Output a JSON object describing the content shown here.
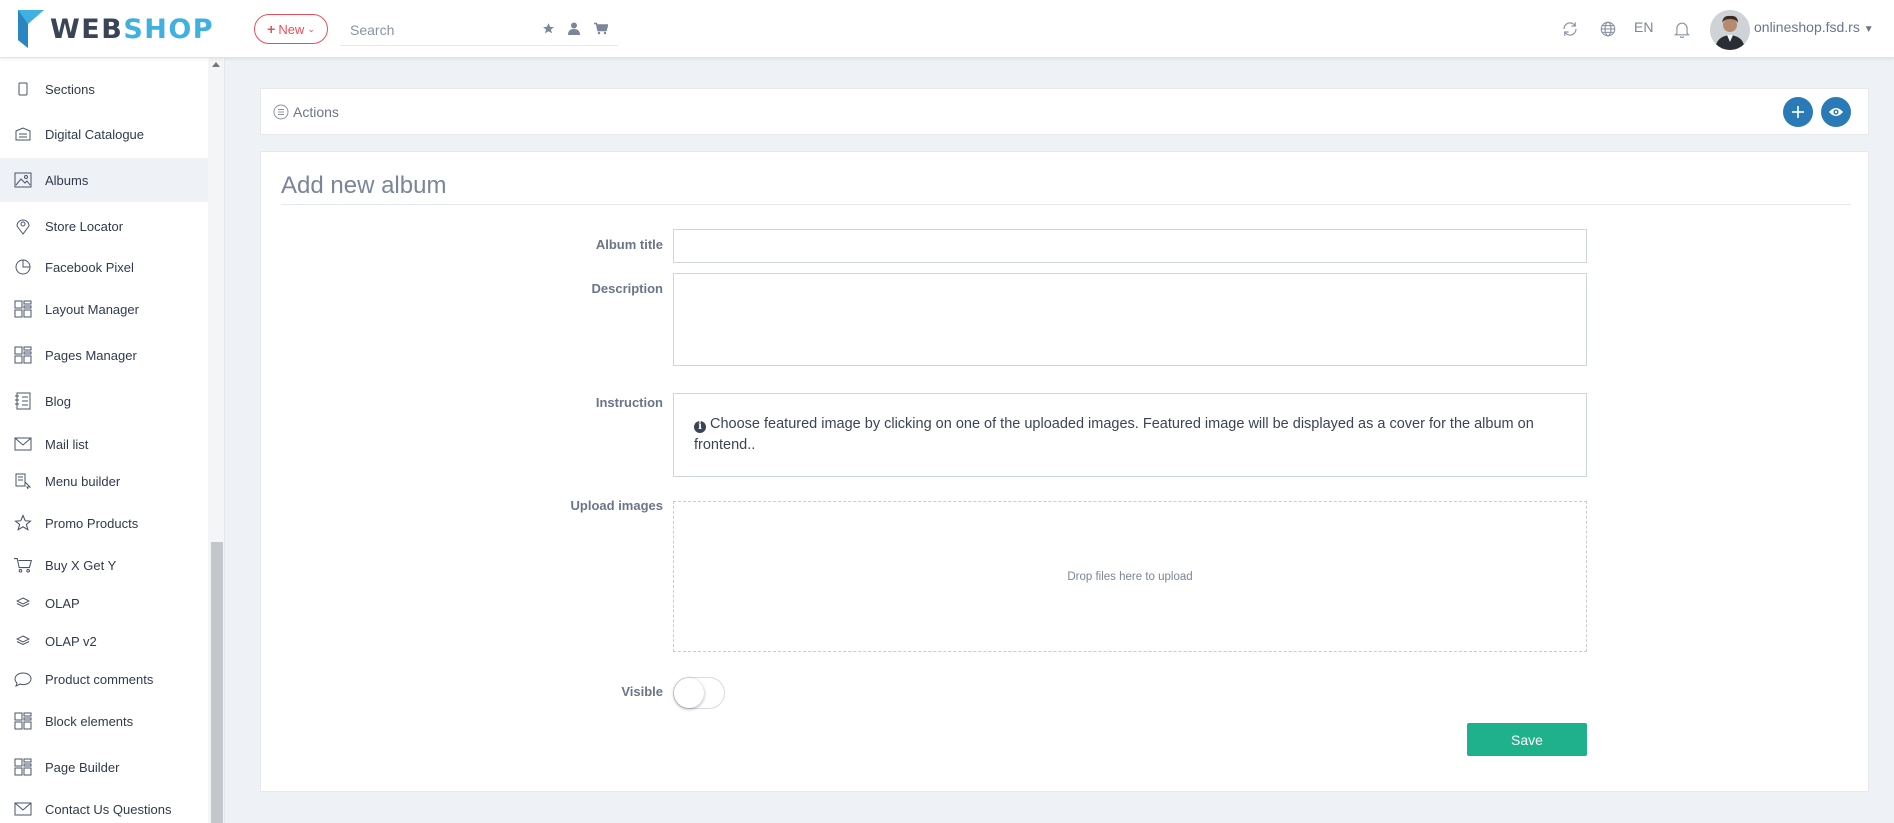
{
  "header": {
    "logo": {
      "part1": "WEB",
      "part2": "SHOP"
    },
    "new_button": {
      "label": "New"
    },
    "search": {
      "placeholder": "Search",
      "value": ""
    },
    "language": "EN",
    "user": {
      "name": "onlineshop.fsd.rs"
    }
  },
  "sidebar": {
    "items": [
      {
        "label": "Sections",
        "icon": "tablet-icon"
      },
      {
        "label": "Digital Catalogue",
        "icon": "catalogue-icon"
      },
      {
        "label": "Albums",
        "icon": "image-icon",
        "active": true
      },
      {
        "label": "Store Locator",
        "icon": "map-pin-icon"
      },
      {
        "label": "Facebook Pixel",
        "icon": "pie-chart-icon"
      },
      {
        "label": "Layout Manager",
        "icon": "layout-icon"
      },
      {
        "label": "Pages Manager",
        "icon": "layout-icon"
      },
      {
        "label": "Blog",
        "icon": "blog-icon"
      },
      {
        "label": "Mail list",
        "icon": "envelope-icon"
      },
      {
        "label": "Menu builder",
        "icon": "menu-builder-icon"
      },
      {
        "label": "Promo Products",
        "icon": "star-icon"
      },
      {
        "label": "Buy X Get Y",
        "icon": "cart-icon"
      },
      {
        "label": "OLAP",
        "icon": "layers-icon"
      },
      {
        "label": "OLAP v2",
        "icon": "layers-icon"
      },
      {
        "label": "Product comments",
        "icon": "comment-icon"
      },
      {
        "label": "Block elements",
        "icon": "layout-icon"
      },
      {
        "label": "Page Builder",
        "icon": "layout-icon"
      },
      {
        "label": "Contact Us Questions",
        "icon": "envelope-icon"
      }
    ]
  },
  "actions": {
    "label": "Actions"
  },
  "form": {
    "title": "Add new album",
    "album_title": {
      "label": "Album title",
      "value": ""
    },
    "description": {
      "label": "Description",
      "value": ""
    },
    "instruction": {
      "label": "Instruction",
      "text": "Choose featured image by clicking on one of the uploaded images. Featured image will be displayed as a cover for the album on frontend.."
    },
    "upload": {
      "label": "Upload images",
      "dropzone_text": "Drop files here to upload"
    },
    "visible": {
      "label": "Visible",
      "checked": false
    },
    "save_label": "Save"
  },
  "colors": {
    "accent_blue": "#2a7ab8",
    "logo_blue": "#3fb0e0",
    "new_red": "#e8505b",
    "save_green": "#1fb08c"
  }
}
